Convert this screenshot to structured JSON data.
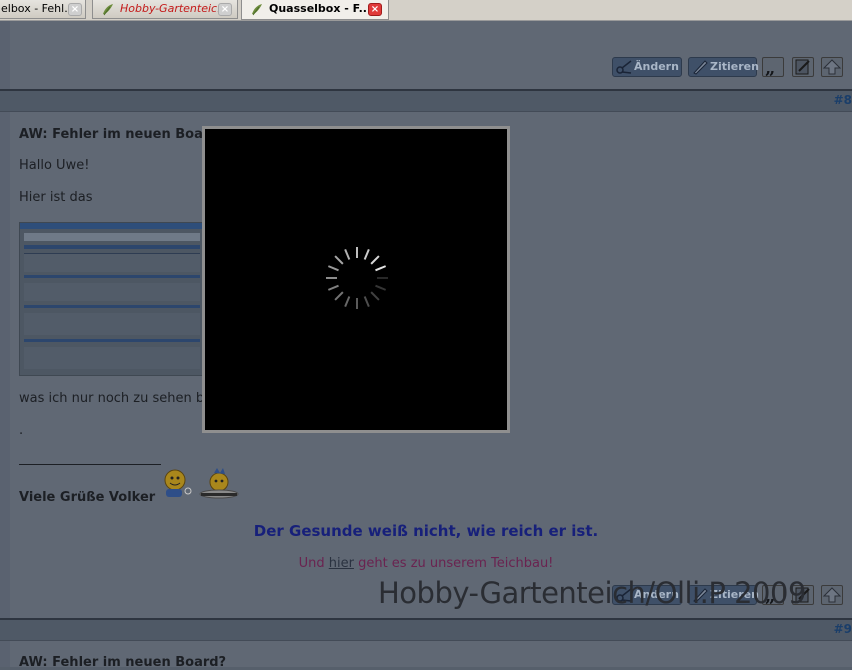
{
  "tabs": [
    {
      "label": "elbox - Fehl...",
      "active": false
    },
    {
      "label": "Hobby-Gartenteic...",
      "active": false
    },
    {
      "label": "Quasselbox - F...",
      "active": true
    }
  ],
  "post_buttons": {
    "edit": "Ändern",
    "quote": "Zitieren"
  },
  "post": {
    "number": "#8",
    "title": "AW: Fehler im neuen Board?",
    "greeting": "Hallo Uwe!",
    "line1": "Hier ist das",
    "line2": "was ich nur noch zu sehen b",
    "dot": ".",
    "signature_name": "Viele Grüße Volker",
    "quote_line": "Der Gesunde weiß nicht, wie reich er ist.",
    "teich_prefix": "Und",
    "teich_link": "hier",
    "teich_suffix": "geht es zu unserem Teichbau!"
  },
  "watermark": "Hobby-Gartenteich/Olli.P 2009",
  "next_post": {
    "number": "#9",
    "title": "AW: Fehler im neuen Board?"
  },
  "colors": {
    "tab_red_text": "#c41a1a",
    "overlay": "#000000",
    "quote_blue": "#17207a",
    "link_magenta": "#6a2350"
  }
}
